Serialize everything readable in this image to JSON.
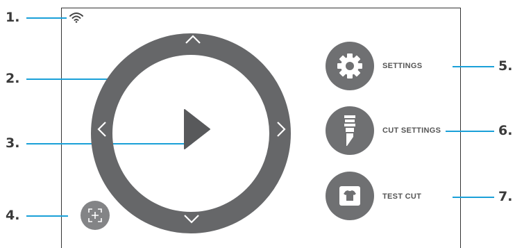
{
  "callouts": {
    "n1": "1.",
    "n2": "2.",
    "n3": "3.",
    "n4": "4.",
    "n5": "5.",
    "n6": "6.",
    "n7": "7."
  },
  "status": {
    "wifi_icon": "wifi-icon"
  },
  "jog": {
    "up_icon": "chevron-up-icon",
    "down_icon": "chevron-down-icon",
    "left_icon": "chevron-left-icon",
    "right_icon": "chevron-right-icon",
    "play_icon": "play-icon"
  },
  "menu": {
    "settings_label": "SETTINGS",
    "cut_settings_label": "CUT SETTINGS",
    "test_cut_label": "TEST CUT"
  },
  "colors": {
    "accent": "#1aa0d8",
    "ring": "#666769",
    "button": "#6f7072"
  }
}
